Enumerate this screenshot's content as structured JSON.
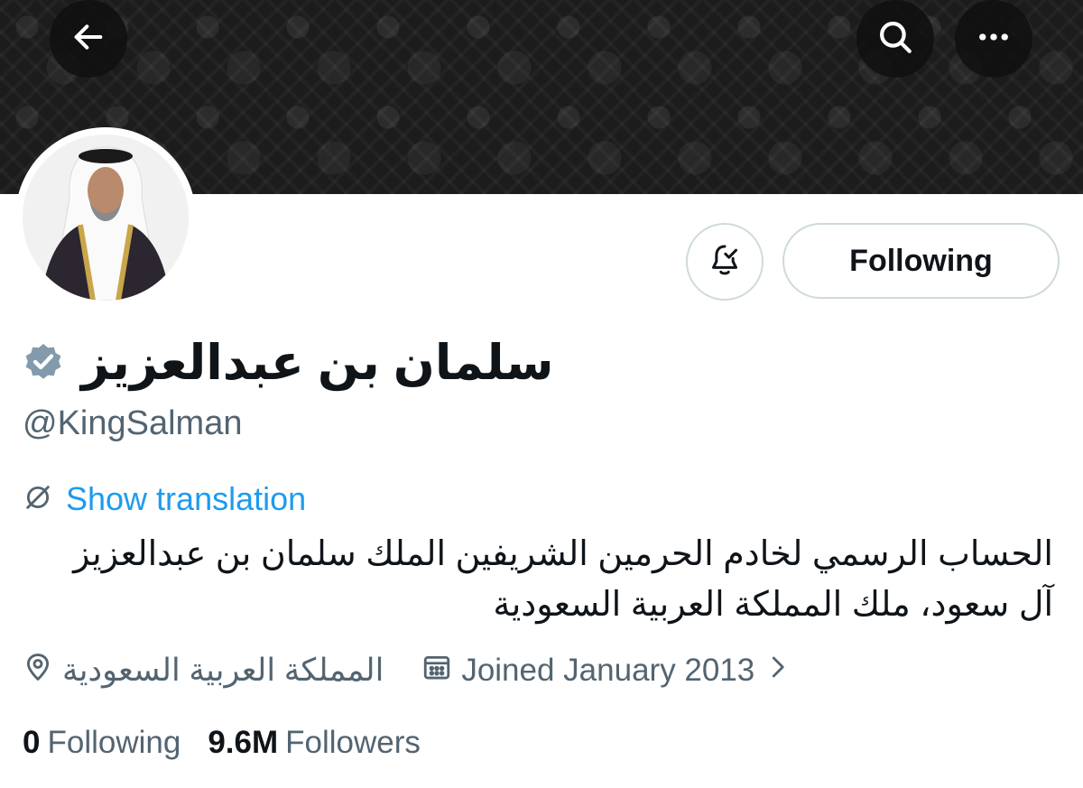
{
  "header": {
    "back_icon": "arrow-left-icon",
    "search_icon": "search-icon",
    "more_icon": "more-horizontal-icon"
  },
  "profile": {
    "display_name": "سلمان بن عبدالعزيز",
    "verified_icon": "verified-badge-icon",
    "verified_color": "#829aab",
    "handle": "@KingSalman",
    "following_button_label": "Following",
    "notification_icon": "bell-check-icon",
    "translate_icon": "globe-translate-icon",
    "show_translation_label": "Show translation",
    "bio_line1": "الحساب الرسمي لخادم الحرمين الشريفين الملك سلمان بن عبدالعزيز",
    "bio_line2": "آل سعود، ملك المملكة العربية السعودية",
    "location_icon": "location-pin-icon",
    "location": "المملكة العربية السعودية",
    "calendar_icon": "calendar-icon",
    "joined": "Joined January 2013",
    "chevron_icon": "chevron-right-icon",
    "following_count": "0",
    "following_label": "Following",
    "followers_count": "9.6M",
    "followers_label": "Followers"
  },
  "colors": {
    "accent": "#1d9bf0",
    "text_primary": "#0f1419",
    "text_secondary": "#536471",
    "border": "#cfd9de"
  }
}
